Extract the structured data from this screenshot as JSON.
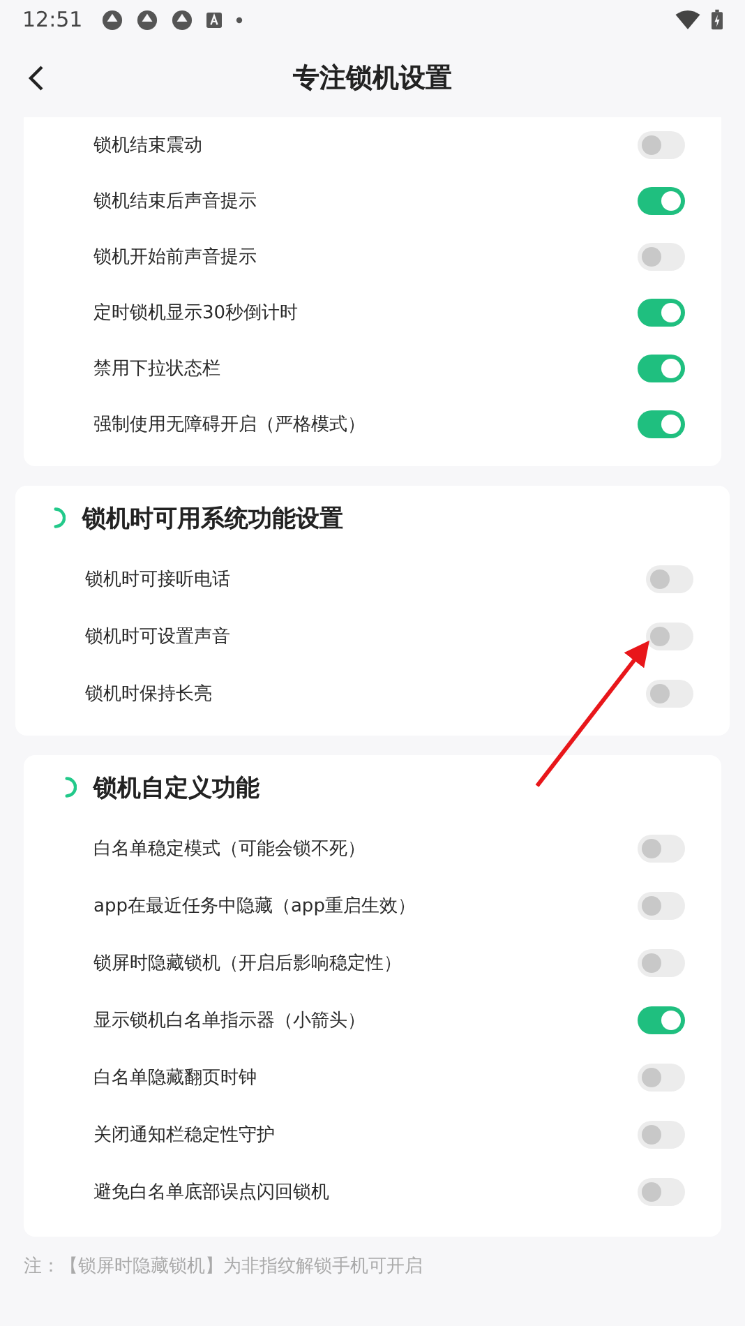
{
  "status_bar": {
    "time": "12:51"
  },
  "header": {
    "title": "专注锁机设置"
  },
  "sections": [
    {
      "items": [
        {
          "label": "锁机结束震动",
          "on": false
        },
        {
          "label": "锁机结束后声音提示",
          "on": true
        },
        {
          "label": "锁机开始前声音提示",
          "on": false
        },
        {
          "label": "定时锁机显示30秒倒计时",
          "on": true
        },
        {
          "label": "禁用下拉状态栏",
          "on": true
        },
        {
          "label": "强制使用无障碍开启（严格模式）",
          "on": true
        }
      ]
    },
    {
      "title": "锁机时可用系统功能设置",
      "items": [
        {
          "label": "锁机时可接听电话",
          "on": false
        },
        {
          "label": "锁机时可设置声音",
          "on": false
        },
        {
          "label": "锁机时保持长亮",
          "on": false
        }
      ]
    },
    {
      "title": "锁机自定义功能",
      "items": [
        {
          "label": "白名单稳定模式（可能会锁不死）",
          "on": false
        },
        {
          "label": "app在最近任务中隐藏（app重启生效）",
          "on": false
        },
        {
          "label": "锁屏时隐藏锁机（开启后影响稳定性）",
          "on": false
        },
        {
          "label": "显示锁机白名单指示器（小箭头）",
          "on": true
        },
        {
          "label": "白名单隐藏翻页时钟",
          "on": false
        },
        {
          "label": "关闭通知栏稳定性守护",
          "on": false
        },
        {
          "label": "避免白名单底部误点闪回锁机",
          "on": false
        }
      ]
    }
  ],
  "note": "注：【锁屏时隐藏锁机】为非指纹解锁手机可开启"
}
